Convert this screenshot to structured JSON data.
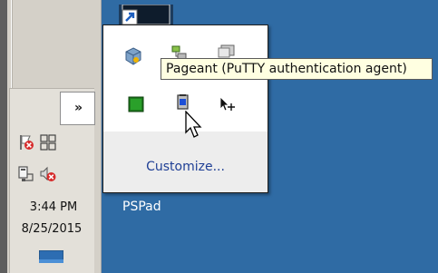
{
  "tray": {
    "overflow_chevron": "»",
    "clock_time": "3:44 PM",
    "clock_date": "8/25/2015"
  },
  "desktop": {
    "pspad_label": "PSPad"
  },
  "popup": {
    "customize_label": "Customize...",
    "icons": [
      "virtualbox-icon",
      "network-icon",
      "monitor-icon",
      "green-square-icon",
      "pageant-icon",
      "move-cursor-icon"
    ]
  },
  "tooltip": {
    "text": "Pageant (PuTTY authentication agent)"
  },
  "colors": {
    "desktop": "#2f6ba4",
    "taskbar": "#d4d0c8",
    "tooltip_bg": "#ffffe1",
    "link": "#1f3f95"
  }
}
